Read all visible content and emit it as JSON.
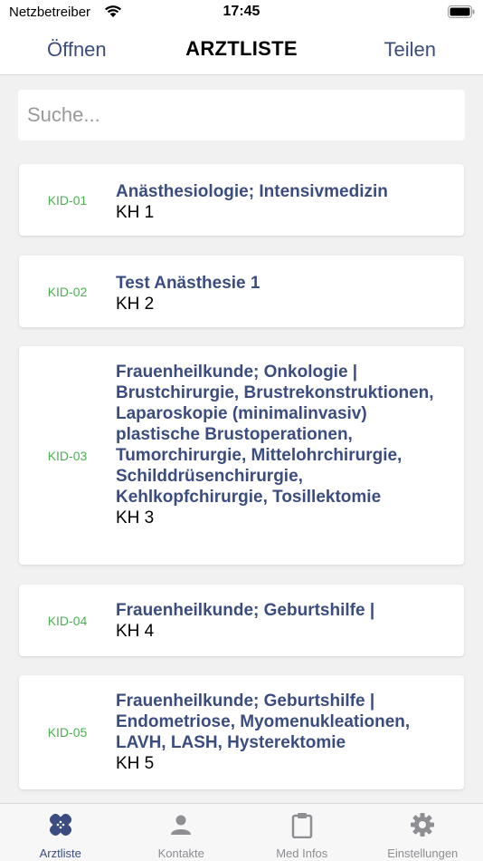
{
  "status": {
    "carrier": "Netzbetreiber",
    "time": "17:45"
  },
  "nav": {
    "left": "Öffnen",
    "title": "ARZTLISTE",
    "right": "Teilen"
  },
  "search": {
    "placeholder": "Suche...",
    "value": ""
  },
  "items": [
    {
      "id": "KID-01",
      "title": "Anästhesiologie; Intensivmedizin",
      "subtitle": "KH 1"
    },
    {
      "id": "KID-02",
      "title": "Test Anästhesie 1",
      "subtitle": "KH 2"
    },
    {
      "id": "KID-03",
      "title": "Frauenheilkunde; Onkologie | Brustchirurgie, Brustrekonstruktionen, Laparoskopie (minimalinvasiv) plastische Brustoperationen, Tumorchirurgie, Mittelohrchirurgie, Schilddrüsenchirurgie, Kehlkopfchirurgie, Tosillektomie",
      "subtitle": "KH 3"
    },
    {
      "id": "KID-04",
      "title": "Frauenheilkunde; Geburtshilfe |",
      "subtitle": "KH 4"
    },
    {
      "id": "KID-05",
      "title": "Frauenheilkunde; Geburtshilfe | Endometriose, Myomenukleationen, LAVH, LASH, Hysterektomie",
      "subtitle": "KH 5"
    }
  ],
  "tabs": [
    {
      "label": "Arztliste",
      "icon": "doctor-list-icon",
      "active": true
    },
    {
      "label": "Kontakte",
      "icon": "person-icon",
      "active": false
    },
    {
      "label": "Med Infos",
      "icon": "clipboard-icon",
      "active": false
    },
    {
      "label": "Einstellungen",
      "icon": "gear-icon",
      "active": false
    }
  ],
  "colors": {
    "accent": "#3b4d80",
    "id_green": "#4caf50",
    "inactive": "#8e8e93"
  }
}
